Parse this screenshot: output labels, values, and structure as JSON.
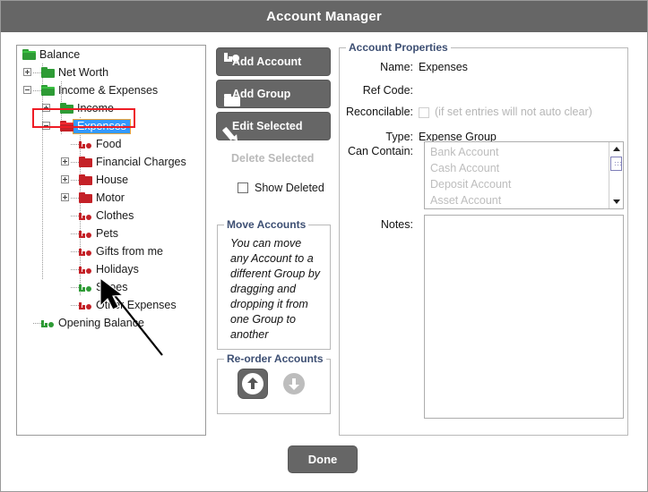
{
  "window": {
    "title": "Account Manager"
  },
  "tree": {
    "name": "account-tree",
    "nodes": [
      {
        "label": "Balance",
        "depth": 0,
        "icon": "folder-open-green",
        "expander": "none",
        "selected": false
      },
      {
        "label": "Net Worth",
        "depth": 1,
        "icon": "folder-green",
        "expander": "plus",
        "selected": false
      },
      {
        "label": "Income & Expenses",
        "depth": 1,
        "icon": "folder-open-green",
        "expander": "minus",
        "selected": false
      },
      {
        "label": "Income",
        "depth": 2,
        "icon": "folder-green",
        "expander": "plus",
        "selected": false
      },
      {
        "label": "Expenses",
        "depth": 2,
        "icon": "folder-open-red",
        "expander": "minus",
        "selected": true
      },
      {
        "label": "Food",
        "depth": 3,
        "icon": "account-red",
        "expander": "none",
        "selected": false
      },
      {
        "label": "Financial Charges",
        "depth": 3,
        "icon": "folder-red",
        "expander": "plus",
        "selected": false
      },
      {
        "label": "House",
        "depth": 3,
        "icon": "folder-red",
        "expander": "plus",
        "selected": false
      },
      {
        "label": "Motor",
        "depth": 3,
        "icon": "folder-red",
        "expander": "plus",
        "selected": false
      },
      {
        "label": "Clothes",
        "depth": 3,
        "icon": "account-red",
        "expander": "none",
        "selected": false
      },
      {
        "label": "Pets",
        "depth": 3,
        "icon": "account-red",
        "expander": "none",
        "selected": false
      },
      {
        "label": "Gifts from me",
        "depth": 3,
        "icon": "account-red",
        "expander": "none",
        "selected": false
      },
      {
        "label": "Holidays",
        "depth": 3,
        "icon": "account-red",
        "expander": "none",
        "selected": false
      },
      {
        "label": "Shoes",
        "depth": 3,
        "icon": "account-green",
        "expander": "none",
        "selected": false
      },
      {
        "label": "Other Expenses",
        "depth": 3,
        "icon": "account-red",
        "expander": "none",
        "selected": false
      },
      {
        "label": "Opening Balance",
        "depth": 1,
        "icon": "account-green",
        "expander": "none",
        "selected": false
      }
    ]
  },
  "actions": {
    "add_account": "Add Account",
    "add_group": "Add Group",
    "edit_selected": "Edit Selected",
    "delete_selected": "Delete Selected",
    "show_deleted": "Show Deleted",
    "show_deleted_checked": false
  },
  "move_accounts": {
    "legend": "Move Accounts",
    "text": "You can move any Account to a different Group by dragging and dropping it from one Group to another"
  },
  "reorder_accounts": {
    "legend": "Re-order Accounts",
    "up_label": "move-up",
    "down_label": "move-down"
  },
  "properties": {
    "legend": "Account Properties",
    "name_label": "Name:",
    "name_value": "Expenses",
    "refcode_label": "Ref Code:",
    "refcode_value": "",
    "reconcilable_label": "Reconcilable:",
    "reconcilable_hint": "(if set entries will not auto clear)",
    "reconcilable_checked": false,
    "type_label": "Type:",
    "type_value": "Expense Group",
    "cancontain_label": "Can Contain:",
    "cancontain_items": [
      "Bank Account",
      "Cash Account",
      "Deposit Account",
      "Asset Account"
    ],
    "notes_label": "Notes:",
    "notes_value": ""
  },
  "footer": {
    "done_label": "Done"
  },
  "colors": {
    "titlebar": "#666666",
    "button": "#666666",
    "group_green": "#2e9b35",
    "group_red": "#c42127",
    "legend": "#3d4f73",
    "selection_fill": "#3399ff",
    "selection_outline": "#e8a33d",
    "annotation_red": "#ee1c25",
    "disabled_text": "#bdbdbd"
  }
}
